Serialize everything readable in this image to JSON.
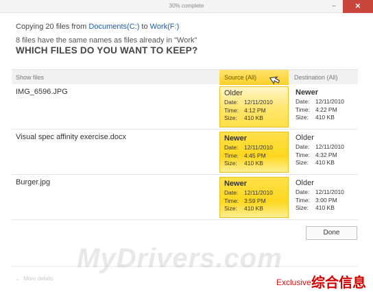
{
  "window": {
    "title": "30% complete",
    "minimize_glyph": "–",
    "close_glyph": "✕"
  },
  "copy": {
    "prefix": "Copying 20 files from",
    "source_link": "Documents(C:)",
    "to": "to",
    "dest_link": "Work(F:)",
    "subtitle": "8 files have the same names as files already in \"Work\"",
    "heading": "WHICH FILES DO YOU WANT TO KEEP?"
  },
  "columns": {
    "show_files": "Show files",
    "source": "Source (All)",
    "destination": "Destination (All)"
  },
  "rows": [
    {
      "name": "IMG_6596.JPG",
      "source": {
        "label": "Older",
        "date": "12/11/2010",
        "time": "4:12 PM",
        "size": "410 KB"
      },
      "dest": {
        "label": "Newer",
        "date": "12/11/2010",
        "time": "4:22 PM",
        "size": "410 KB"
      }
    },
    {
      "name": "Visual spec affinity exercise.docx",
      "source": {
        "label": "Newer",
        "date": "12/11/2010",
        "time": "4:45 PM",
        "size": "410 KB"
      },
      "dest": {
        "label": "Older",
        "date": "12/11/2010",
        "time": "4:32 PM",
        "size": "410 KB"
      }
    },
    {
      "name": "Burger.jpg",
      "source": {
        "label": "Newer",
        "date": "12/11/2010",
        "time": "3:59 PM",
        "size": "410 KB"
      },
      "dest": {
        "label": "Older",
        "date": "12/11/2010",
        "time": "3:00 PM",
        "size": "410 KB"
      }
    }
  ],
  "field_labels": {
    "date": "Date:",
    "time": "Time:",
    "size": "Size:"
  },
  "buttons": {
    "done": "Done"
  },
  "footer": {
    "more_details": "More details",
    "chevron": "⌄"
  },
  "watermarks": {
    "site": "MyDrivers.com",
    "exclusive": "Exclusive",
    "cn": "综合信息"
  },
  "colors": {
    "accent_yellow": "#fbd02b",
    "link_blue": "#1b5ea8",
    "close_red": "#c9463d"
  }
}
